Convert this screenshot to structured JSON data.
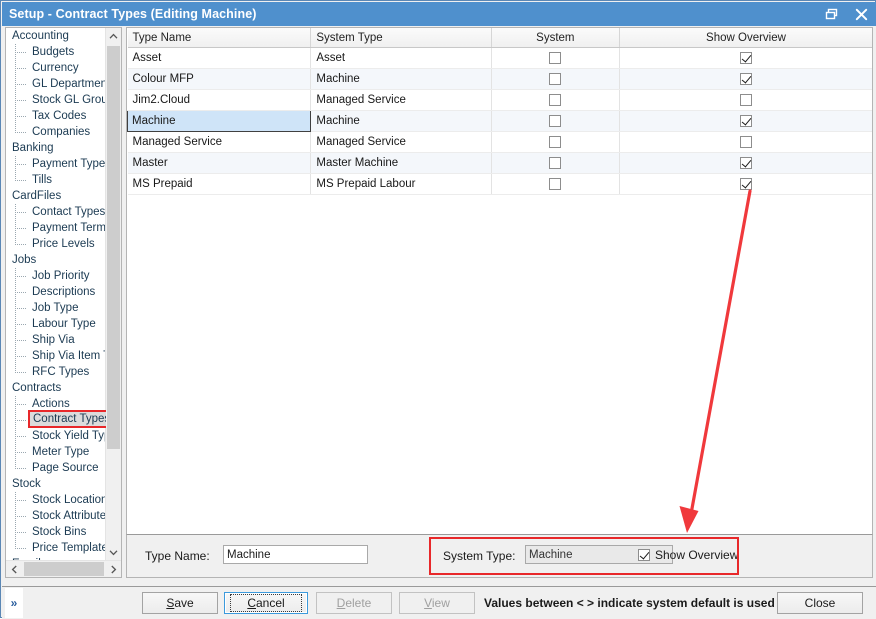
{
  "window": {
    "title": "Setup - Contract Types (Editing Machine)",
    "restore_icon": "restore-icon",
    "close_icon": "close-icon",
    "accent_color": "#4f90cd",
    "annotation_color": "#e8282a"
  },
  "sidebar": {
    "items": [
      {
        "label": "Accounting",
        "type": "group"
      },
      {
        "label": "Budgets",
        "type": "child"
      },
      {
        "label": "Currency",
        "type": "child"
      },
      {
        "label": "GL Departments",
        "type": "child"
      },
      {
        "label": "Stock GL Groups",
        "type": "child"
      },
      {
        "label": "Tax Codes",
        "type": "child"
      },
      {
        "label": "Companies",
        "type": "child",
        "last": true
      },
      {
        "label": "Banking",
        "type": "group"
      },
      {
        "label": "Payment Type",
        "type": "child"
      },
      {
        "label": "Tills",
        "type": "child",
        "last": true
      },
      {
        "label": "CardFiles",
        "type": "group"
      },
      {
        "label": "Contact Types",
        "type": "child"
      },
      {
        "label": "Payment Terms",
        "type": "child"
      },
      {
        "label": "Price Levels",
        "type": "child",
        "last": true
      },
      {
        "label": "Jobs",
        "type": "group"
      },
      {
        "label": "Job Priority",
        "type": "child"
      },
      {
        "label": "Descriptions",
        "type": "child"
      },
      {
        "label": "Job Type",
        "type": "child"
      },
      {
        "label": "Labour Type",
        "type": "child"
      },
      {
        "label": "Ship Via",
        "type": "child"
      },
      {
        "label": "Ship Via Item Types",
        "type": "child"
      },
      {
        "label": "RFC Types",
        "type": "child",
        "last": true
      },
      {
        "label": "Contracts",
        "type": "group"
      },
      {
        "label": "Actions",
        "type": "child"
      },
      {
        "label": "Contract Types",
        "type": "child",
        "selected": true,
        "highlighted": true
      },
      {
        "label": "Stock Yield Types",
        "type": "child"
      },
      {
        "label": "Meter Type",
        "type": "child"
      },
      {
        "label": "Page Source",
        "type": "child",
        "last": true
      },
      {
        "label": "Stock",
        "type": "group"
      },
      {
        "label": "Stock Locations",
        "type": "child"
      },
      {
        "label": "Stock Attributes",
        "type": "child"
      },
      {
        "label": "Stock Bins",
        "type": "child"
      },
      {
        "label": "Price Templates",
        "type": "child",
        "last": true
      },
      {
        "label": "Email",
        "type": "group"
      }
    ],
    "scroll_up_icon": "chevron-up-icon",
    "scroll_down_icon": "chevron-down-icon",
    "scroll_left_icon": "chevron-left-icon",
    "scroll_right_icon": "chevron-right-icon"
  },
  "grid": {
    "columns": [
      "Type Name",
      "System Type",
      "System",
      "Show Overview"
    ],
    "rows": [
      {
        "type_name": "Asset",
        "system_type": "Asset",
        "system": false,
        "show_overview": true
      },
      {
        "type_name": "Colour MFP",
        "system_type": "Machine",
        "system": false,
        "show_overview": true
      },
      {
        "type_name": "Jim2.Cloud",
        "system_type": "Managed Service",
        "system": false,
        "show_overview": false
      },
      {
        "type_name": "Machine",
        "system_type": "Machine",
        "system": false,
        "show_overview": true,
        "selected": true
      },
      {
        "type_name": "Managed Service",
        "system_type": "Managed Service",
        "system": false,
        "show_overview": false
      },
      {
        "type_name": "Master",
        "system_type": "Master Machine",
        "system": false,
        "show_overview": true
      },
      {
        "type_name": "MS Prepaid",
        "system_type": "MS Prepaid Labour",
        "system": false,
        "show_overview": true
      }
    ]
  },
  "edit_panel": {
    "type_name_label": "Type Name:",
    "type_name_value": "Machine",
    "system_type_label": "System Type:",
    "system_type_value": "Machine",
    "show_overview_label": "Show Overview",
    "show_overview_checked": true
  },
  "bottom_bar": {
    "expander_icon": "chevron-double-right-icon",
    "buttons": [
      {
        "label": "Save",
        "mnemonic": "S",
        "state": "enabled"
      },
      {
        "label": "Cancel",
        "mnemonic": "C",
        "state": "focused"
      },
      {
        "label": "Delete",
        "mnemonic": "D",
        "state": "disabled"
      },
      {
        "label": "View",
        "mnemonic": "V",
        "state": "disabled"
      }
    ],
    "hint": "Values between < > indicate system default is used",
    "close_label": "Close"
  }
}
